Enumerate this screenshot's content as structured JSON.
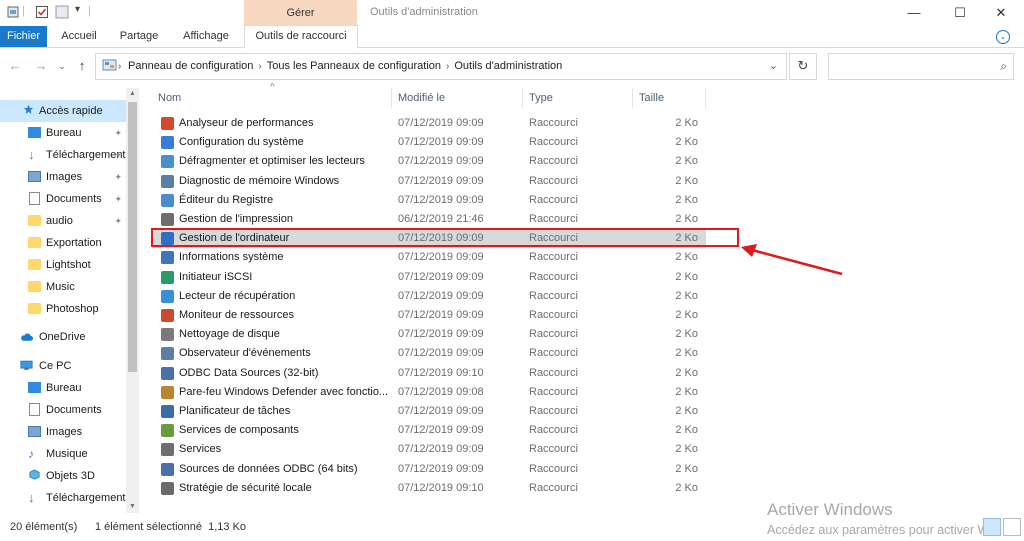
{
  "titlebar": {
    "context_tab": "Gérer",
    "window_title": "Outils d'administration",
    "minimize": "—",
    "maximize": "☐",
    "close": "✕"
  },
  "ribbon": {
    "tabs": [
      "Fichier",
      "Accueil",
      "Partage",
      "Affichage",
      "Outils de raccourci"
    ],
    "expand_icon": "⌄"
  },
  "address": {
    "back": "←",
    "forward": "→",
    "dropdown": "⌄",
    "up": "↑",
    "crumbs": [
      "Panneau de configuration",
      "Tous les Panneaux de configuration",
      "Outils d'administration"
    ],
    "separator": "›",
    "expand": "⌄",
    "refresh": "↻",
    "search_placeholder": "",
    "search_icon": "⌕"
  },
  "nav": {
    "items": [
      {
        "label": "Accès rapide",
        "icon": "star-icon",
        "pinned": false
      },
      {
        "label": "Bureau",
        "icon": "desktop-icon",
        "pinned": true
      },
      {
        "label": "Téléchargements",
        "icon": "download-icon",
        "pinned": true
      },
      {
        "label": "Images",
        "icon": "pictures-icon",
        "pinned": true
      },
      {
        "label": "Documents",
        "icon": "documents-icon",
        "pinned": true
      },
      {
        "label": "audio",
        "icon": "folder-icon",
        "pinned": true
      },
      {
        "label": "Exportation",
        "icon": "folder-icon",
        "pinned": false
      },
      {
        "label": "Lightshot",
        "icon": "folder-icon",
        "pinned": false
      },
      {
        "label": "Music",
        "icon": "folder-icon",
        "pinned": false
      },
      {
        "label": "Photoshop",
        "icon": "folder-icon",
        "pinned": false
      },
      {
        "label": "OneDrive",
        "icon": "cloud-icon",
        "pinned": false
      },
      {
        "label": "Ce PC",
        "icon": "computer-icon",
        "pinned": false
      },
      {
        "label": "Bureau",
        "icon": "desktop-icon",
        "pinned": false
      },
      {
        "label": "Documents",
        "icon": "documents-icon",
        "pinned": false
      },
      {
        "label": "Images",
        "icon": "pictures-icon",
        "pinned": false
      },
      {
        "label": "Musique",
        "icon": "music-icon",
        "pinned": false
      },
      {
        "label": "Objets 3D",
        "icon": "3d-objects-icon",
        "pinned": false
      },
      {
        "label": "Téléchargements",
        "icon": "download-icon",
        "pinned": false
      }
    ],
    "pin_icon": "📌"
  },
  "columns": {
    "name": "Nom",
    "modified": "Modifié le",
    "type": "Type",
    "size": "Taille",
    "sort_caret": "^"
  },
  "files": [
    {
      "name": "Analyseur de performances",
      "date": "07/12/2019 09:09",
      "type": "Raccourci",
      "size": "2 Ko",
      "color": "#d04a2b"
    },
    {
      "name": "Configuration du système",
      "date": "07/12/2019 09:09",
      "type": "Raccourci",
      "size": "2 Ko",
      "color": "#3a7bd5"
    },
    {
      "name": "Défragmenter et optimiser les lecteurs",
      "date": "07/12/2019 09:09",
      "type": "Raccourci",
      "size": "2 Ko",
      "color": "#4a90c8"
    },
    {
      "name": "Diagnostic de mémoire Windows",
      "date": "07/12/2019 09:09",
      "type": "Raccourci",
      "size": "2 Ko",
      "color": "#5b7fa6"
    },
    {
      "name": "Éditeur du Registre",
      "date": "07/12/2019 09:09",
      "type": "Raccourci",
      "size": "2 Ko",
      "color": "#4c8bd0"
    },
    {
      "name": "Gestion de l'impression",
      "date": "06/12/2019 21:46",
      "type": "Raccourci",
      "size": "2 Ko",
      "color": "#6e6e6e"
    },
    {
      "name": "Gestion de l'ordinateur",
      "date": "07/12/2019 09:09",
      "type": "Raccourci",
      "size": "2 Ko",
      "color": "#2d6fc1"
    },
    {
      "name": "Informations système",
      "date": "07/12/2019 09:09",
      "type": "Raccourci",
      "size": "2 Ko",
      "color": "#3f77b8"
    },
    {
      "name": "Initiateur iSCSI",
      "date": "07/12/2019 09:09",
      "type": "Raccourci",
      "size": "2 Ko",
      "color": "#2a9a6a"
    },
    {
      "name": "Lecteur de récupération",
      "date": "07/12/2019 09:09",
      "type": "Raccourci",
      "size": "2 Ko",
      "color": "#3a8fd6"
    },
    {
      "name": "Moniteur de ressources",
      "date": "07/12/2019 09:09",
      "type": "Raccourci",
      "size": "2 Ko",
      "color": "#c94a2e"
    },
    {
      "name": "Nettoyage de disque",
      "date": "07/12/2019 09:09",
      "type": "Raccourci",
      "size": "2 Ko",
      "color": "#7a7a7a"
    },
    {
      "name": "Observateur d'événements",
      "date": "07/12/2019 09:09",
      "type": "Raccourci",
      "size": "2 Ko",
      "color": "#5c7fa3"
    },
    {
      "name": "ODBC Data Sources (32-bit)",
      "date": "07/12/2019 09:10",
      "type": "Raccourci",
      "size": "2 Ko",
      "color": "#4a72a8"
    },
    {
      "name": "Pare-feu Windows Defender avec fonctio...",
      "date": "07/12/2019 09:08",
      "type": "Raccourci",
      "size": "2 Ko",
      "color": "#b8862f"
    },
    {
      "name": "Planificateur de tâches",
      "date": "07/12/2019 09:09",
      "type": "Raccourci",
      "size": "2 Ko",
      "color": "#3b6ea8"
    },
    {
      "name": "Services de composants",
      "date": "07/12/2019 09:09",
      "type": "Raccourci",
      "size": "2 Ko",
      "color": "#6a9c3c"
    },
    {
      "name": "Services",
      "date": "07/12/2019 09:09",
      "type": "Raccourci",
      "size": "2 Ko",
      "color": "#6e6e6e"
    },
    {
      "name": "Sources de données ODBC (64 bits)",
      "date": "07/12/2019 09:09",
      "type": "Raccourci",
      "size": "2 Ko",
      "color": "#4a72a8"
    },
    {
      "name": "Stratégie de sécurité locale",
      "date": "07/12/2019 09:10",
      "type": "Raccourci",
      "size": "2 Ko",
      "color": "#6a6a6a"
    }
  ],
  "selected_file": "Gestion de l'ordinateur",
  "status": {
    "count": "20 élément(s)",
    "selection": "1 élément sélectionné  1,13 Ko"
  },
  "watermark": {
    "line1": "Activer Windows",
    "line2": "Accédez aux paramètres pour activer Wi"
  },
  "colors": {
    "accent": "#1979ca",
    "annotation": "#e0191c",
    "selection": "#cce8ff"
  }
}
